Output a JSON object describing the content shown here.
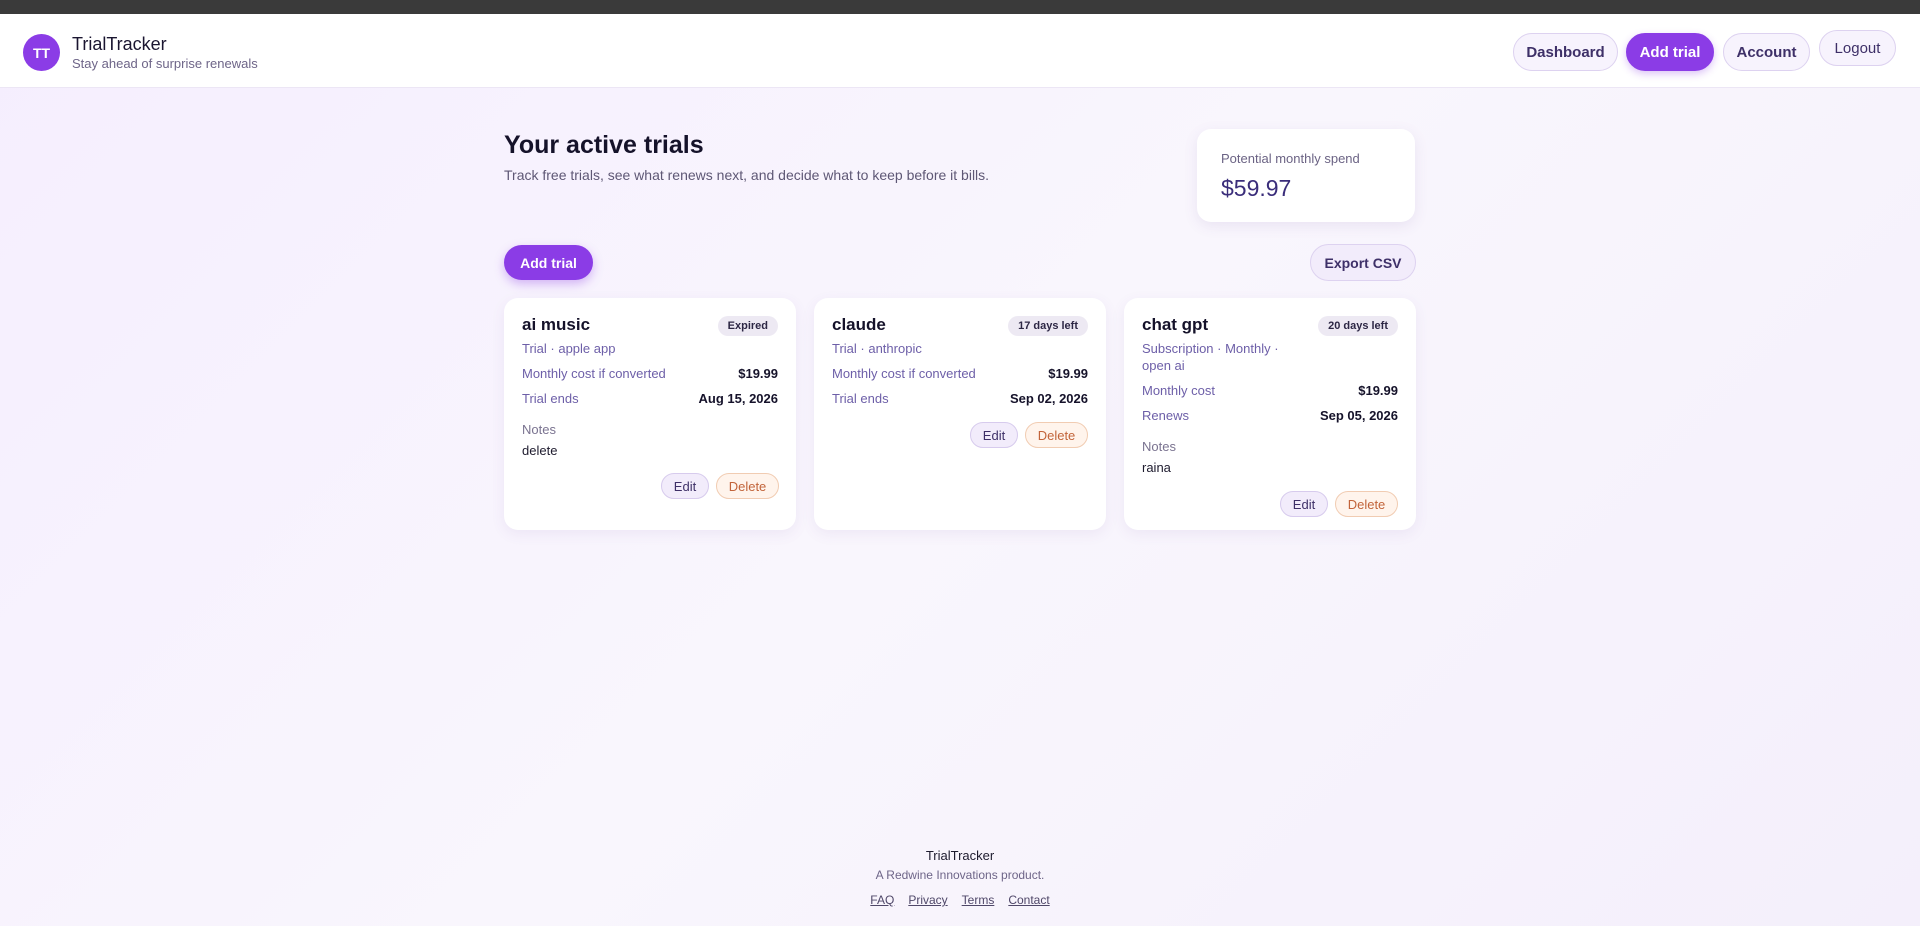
{
  "header": {
    "avatar_initials": "TT",
    "brand_title": "TrialTracker",
    "brand_tagline": "Stay ahead of surprise renewals",
    "nav": {
      "dashboard": "Dashboard",
      "add_trial": "Add trial",
      "account": "Account",
      "logout": "Logout"
    }
  },
  "main": {
    "heading": "Your active trials",
    "subheading": "Track free trials, see what renews next, and decide what to keep before it bills.",
    "spend": {
      "label": "Potential monthly spend",
      "value": "$59.97"
    },
    "add_trial_label": "Add trial",
    "export_label": "Export CSV",
    "cards": [
      {
        "name": "ai music",
        "badge": "Expired",
        "meta": "Trial · apple app",
        "row1_label": "Monthly cost if converted",
        "row1_value": "$19.99",
        "row2_label": "Trial ends",
        "row2_value": "Aug 15, 2026",
        "notes_label": "Notes",
        "notes_value": "delete",
        "edit": "Edit",
        "delete": "Delete"
      },
      {
        "name": "claude",
        "badge": "17 days left",
        "meta": "Trial · anthropic",
        "row1_label": "Monthly cost if converted",
        "row1_value": "$19.99",
        "row2_label": "Trial ends",
        "row2_value": "Sep 02, 2026",
        "edit": "Edit",
        "delete": "Delete"
      },
      {
        "name": "chat gpt",
        "badge": "20 days left",
        "meta": "Subscription · Monthly · open ai",
        "row1_label": "Monthly cost",
        "row1_value": "$19.99",
        "row2_label": "Renews",
        "row2_value": "Sep 05, 2026",
        "notes_label": "Notes",
        "notes_value": "raina",
        "edit": "Edit",
        "delete": "Delete"
      }
    ]
  },
  "footer": {
    "title": "TrialTracker",
    "subtitle": "A Redwine Innovations product.",
    "links": [
      "FAQ",
      "Privacy",
      "Terms",
      "Contact"
    ]
  },
  "colors": {
    "accent": "#8b3ce6",
    "danger": "#c2643a",
    "text": "#15122a"
  }
}
